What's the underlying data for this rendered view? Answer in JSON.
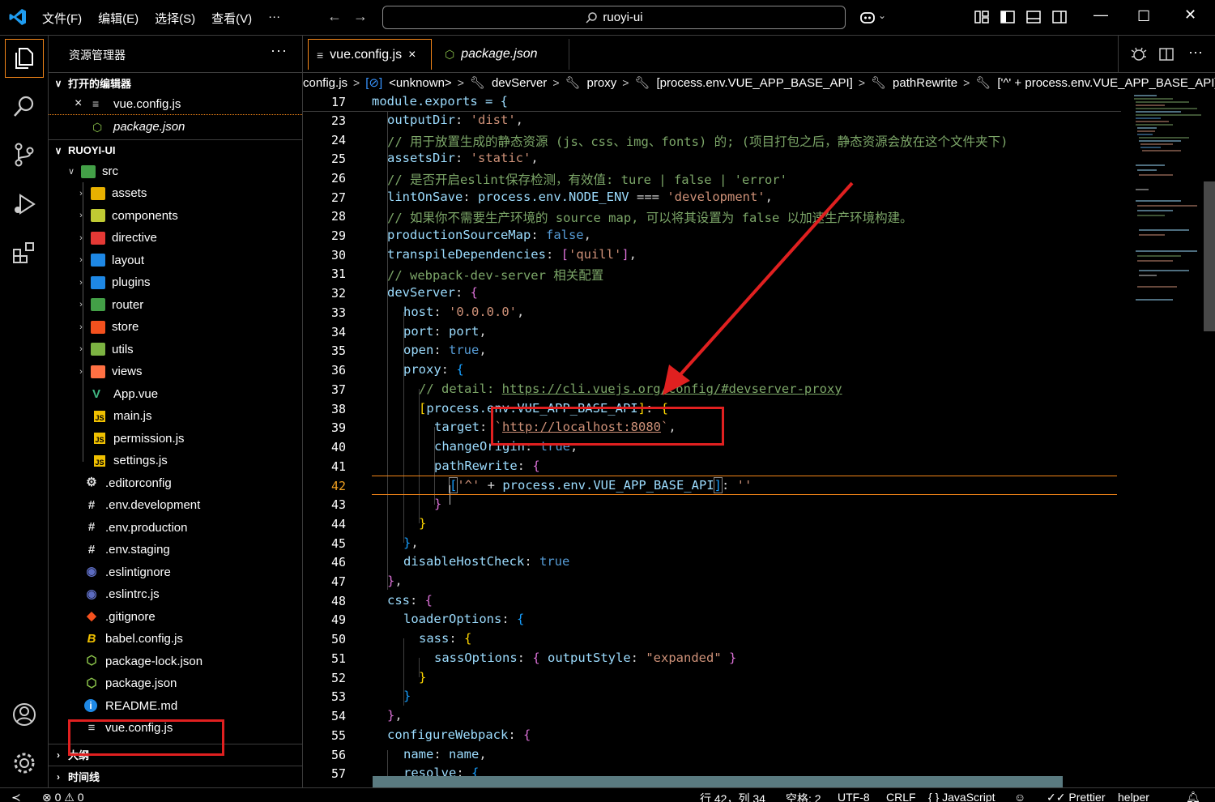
{
  "titlebar": {
    "menu": [
      "文件(F)",
      "编辑(E)",
      "选择(S)",
      "查看(V)",
      "···"
    ],
    "search": "ruoyi-ui"
  },
  "sidebar": {
    "title": "资源管理器",
    "more": "···",
    "open_editors_label": "打开的编辑器",
    "open_editors": [
      {
        "name": "vue.config.js",
        "close": "×",
        "italic": false
      },
      {
        "name": "package.json",
        "italic": true
      }
    ],
    "project_label": "RUOYI-UI",
    "src_label": "src",
    "folders": [
      {
        "name": "assets",
        "color": "#e8b100"
      },
      {
        "name": "components",
        "color": "#c0ca33"
      },
      {
        "name": "directive",
        "color": "#e53935"
      },
      {
        "name": "layout",
        "color": "#1e88e5"
      },
      {
        "name": "plugins",
        "color": "#1e88e5"
      },
      {
        "name": "router",
        "color": "#43a047"
      },
      {
        "name": "store",
        "color": "#f4511e"
      },
      {
        "name": "utils",
        "color": "#7cb342"
      },
      {
        "name": "views",
        "color": "#ff7043"
      }
    ],
    "src_files": [
      {
        "name": "App.vue",
        "icon": "V",
        "color": "#41b883"
      },
      {
        "name": "main.js",
        "icon": "JS",
        "color": "#f0c000"
      },
      {
        "name": "permission.js",
        "icon": "JS",
        "color": "#f0c000"
      },
      {
        "name": "settings.js",
        "icon": "JS",
        "color": "#f0c000"
      }
    ],
    "root_files": [
      {
        "name": ".editorconfig",
        "icon": "⚙",
        "color": "#ddd"
      },
      {
        "name": ".env.development",
        "icon": "#",
        "color": "#ddd"
      },
      {
        "name": ".env.production",
        "icon": "#",
        "color": "#ddd"
      },
      {
        "name": ".env.staging",
        "icon": "#",
        "color": "#ddd"
      },
      {
        "name": ".eslintignore",
        "icon": "◉",
        "color": "#5c6bc0"
      },
      {
        "name": ".eslintrc.js",
        "icon": "◉",
        "color": "#5c6bc0"
      },
      {
        "name": ".gitignore",
        "icon": "◆",
        "color": "#f4511e"
      },
      {
        "name": "babel.config.js",
        "icon": "B",
        "color": "#f0c000"
      },
      {
        "name": "package-lock.json",
        "icon": "⬡",
        "color": "#8bc34a"
      },
      {
        "name": "package.json",
        "icon": "⬡",
        "color": "#8bc34a"
      },
      {
        "name": "README.md",
        "icon": "i",
        "color": "#1e88e5"
      },
      {
        "name": "vue.config.js",
        "icon": "≡",
        "color": "#ccc"
      }
    ],
    "outline_label": "大纲",
    "timeline_label": "时间线"
  },
  "tabs": [
    {
      "label": "vue.config.js",
      "close": "×",
      "active": true
    },
    {
      "label": "package.json",
      "active": false
    }
  ],
  "breadcrumb": [
    "config.js",
    "<unknown>",
    "devServer",
    "proxy",
    "[process.env.VUE_APP_BASE_API]",
    "pathRewrite",
    "['^' + process.env.VUE_APP_BASE_API]"
  ],
  "editor": {
    "sticky_line": {
      "num": "17",
      "text": "module.exports = {"
    },
    "line_numbers": [
      "23",
      "24",
      "25",
      "26",
      "27",
      "28",
      "29",
      "30",
      "31",
      "32",
      "33",
      "34",
      "35",
      "36",
      "37",
      "38",
      "39",
      "40",
      "41",
      "42",
      "43",
      "44",
      "45",
      "46",
      "47",
      "48",
      "49",
      "50",
      "51",
      "52",
      "53",
      "54",
      "55",
      "56",
      "57"
    ],
    "current_line": "42",
    "lines": {
      "l23": {
        "a": "outputDir",
        "b": "'dist'"
      },
      "l24": "// 用于放置生成的静态资源 (js、css、img、fonts) 的; (项目打包之后，静态资源会放在这个文件夹下)",
      "l25": {
        "a": "assetsDir",
        "b": "'static'"
      },
      "l26": "// 是否开启eslint保存检测，有效值: ture | false | 'error'",
      "l27": {
        "a": "lintOnSave",
        "b": "process.env.NODE_ENV",
        "c": "===",
        "d": "'development'"
      },
      "l28": "// 如果你不需要生产环境的 source map, 可以将其设置为 false 以加速生产环境构建。",
      "l29": {
        "a": "productionSourceMap",
        "b": "false"
      },
      "l30": {
        "a": "transpileDependencies",
        "b": "'quill'"
      },
      "l31": "// webpack-dev-server 相关配置",
      "l32": {
        "a": "devServer"
      },
      "l33": {
        "a": "host",
        "b": "'0.0.0.0'"
      },
      "l34": {
        "a": "port",
        "b": "port"
      },
      "l35": {
        "a": "open",
        "b": "true"
      },
      "l36": {
        "a": "proxy"
      },
      "l37": {
        "a": "// detail: ",
        "b": "https://cli.vuejs.org/config/#devserver-proxy"
      },
      "l38": {
        "a": "process.env.VUE_APP_BASE_API"
      },
      "l39": {
        "a": "target",
        "b": "http://localhost:8080"
      },
      "l40": {
        "a": "changeOrigin",
        "b": "true"
      },
      "l41": {
        "a": "pathRewrite"
      },
      "l42": {
        "a": "'^'",
        "b": "process.env.VUE_APP_BASE_API",
        "c": "''"
      },
      "l46": {
        "a": "disableHostCheck",
        "b": "true"
      },
      "l48": {
        "a": "css"
      },
      "l49": {
        "a": "loaderOptions"
      },
      "l50": {
        "a": "sass"
      },
      "l51": {
        "a": "sassOptions",
        "b": "outputStyle",
        "c": "\"expanded\""
      },
      "l55": {
        "a": "configureWebpack"
      },
      "l56": {
        "a": "name",
        "b": "name"
      },
      "l57": {
        "a": "resolve"
      }
    }
  },
  "statusbar": {
    "errors": "⊗ 0 ⚠ 0",
    "position": "行 42，列 34",
    "spaces": "空格: 2",
    "encoding": "UTF-8",
    "eol": "CRLF",
    "language": "{ } JavaScript",
    "prettier": "✓✓ Prettier",
    "helper": "helper"
  },
  "colors": {
    "accent": "#f38518",
    "annotation": "#e02020",
    "string": "#ce9178",
    "property": "#9cdcfe",
    "keyword": "#569cd6",
    "comment": "#7ca668"
  }
}
